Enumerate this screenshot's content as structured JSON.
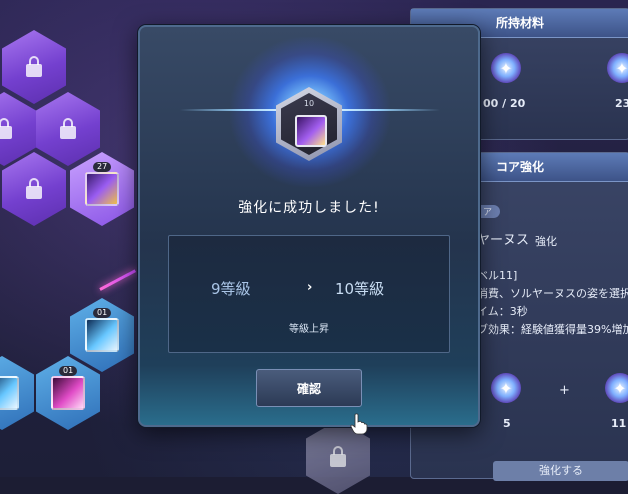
{
  "materials_panel": {
    "title": "所持材料",
    "count_left": "00 / 20",
    "count_right": "23"
  },
  "enhance_panel": {
    "title": "コア強化",
    "badge": "ア",
    "skill_name": "ヤーヌス",
    "skill_action": "強化",
    "desc_lines": [
      "ベル11]",
      "消費、ソルヤーヌスの姿を選択",
      "イム：3秒",
      "ブ効果：経験値獲得量39%増加"
    ],
    "cost_left": "5",
    "plus": "+",
    "cost_right": "11",
    "button_label": "強化する"
  },
  "skill_tree": {
    "badges": [
      "27",
      "01",
      "01"
    ]
  },
  "modal": {
    "core_level": "10",
    "success_message": "強化に成功しました!",
    "grade_from": "9等級",
    "grade_arrow": "›",
    "grade_to": "10等級",
    "grade_note": "等級上昇",
    "confirm_label": "確認"
  }
}
